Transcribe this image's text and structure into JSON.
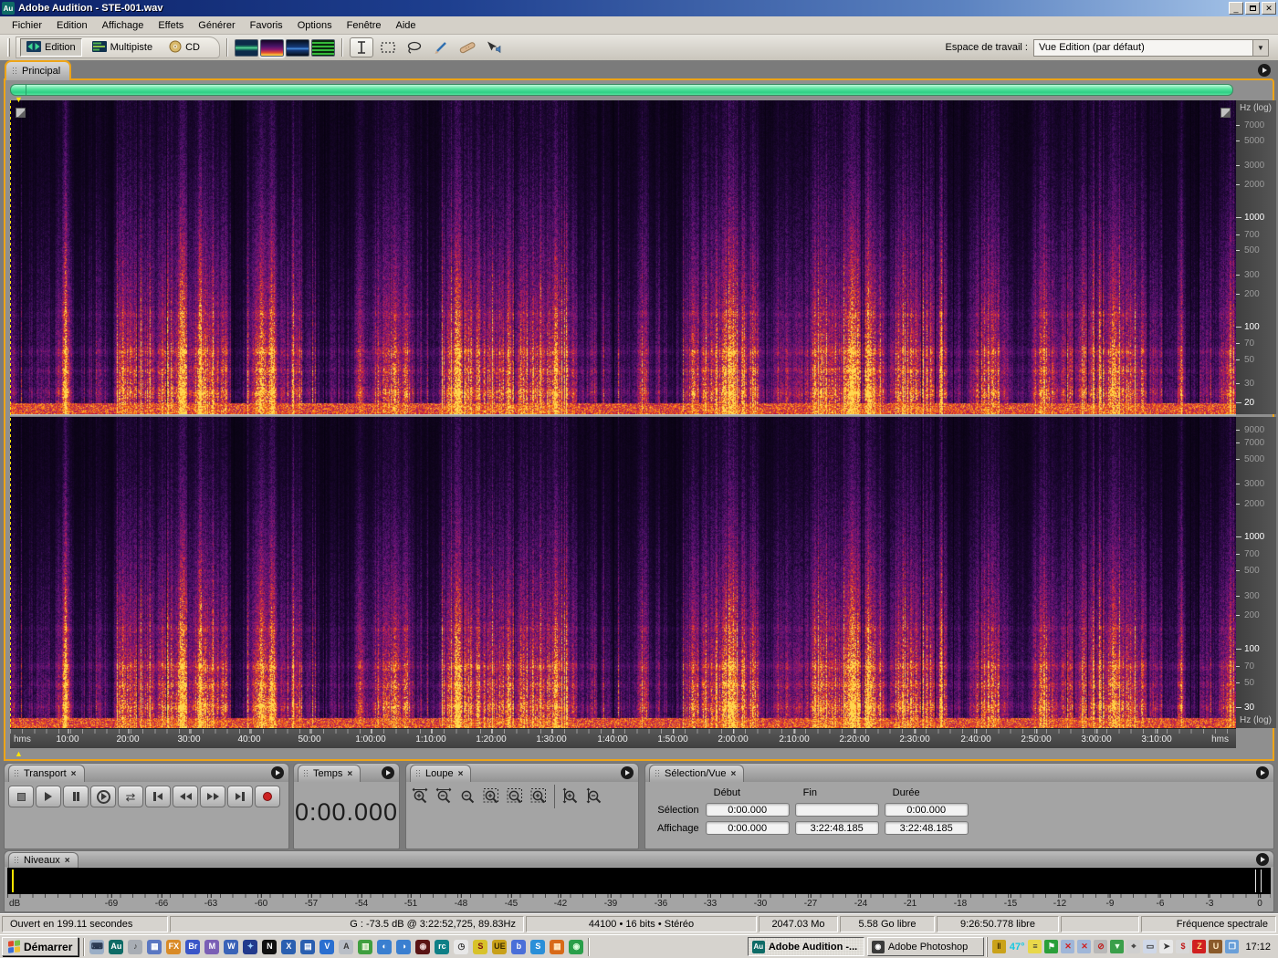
{
  "window": {
    "title": "Adobe Audition - STE-001.wav",
    "icon_label": "Au"
  },
  "icons": {
    "close_small": "×",
    "minimize": "_",
    "close_x": "✕",
    "dropdown": "▼",
    "marker_down": "▼",
    "marker_up": "▲",
    "loop": "⇄"
  },
  "menu": {
    "items": [
      "Fichier",
      "Edition",
      "Affichage",
      "Effets",
      "Générer",
      "Favoris",
      "Options",
      "Fenêtre",
      "Aide"
    ]
  },
  "toolbar": {
    "modes": [
      {
        "label": "Edition",
        "active": true
      },
      {
        "label": "Multipiste",
        "active": false
      },
      {
        "label": "CD",
        "active": false
      }
    ],
    "views": [
      "waveform-view",
      "spectral-frequency-view",
      "spectral-pan-view",
      "spectral-phase-view"
    ],
    "active_view": 1,
    "tools": [
      "time-selection-tool",
      "marquee-selection-tool",
      "lasso-selection-tool",
      "effects-paintbrush-tool",
      "spot-healing-tool",
      "scrub-tool"
    ],
    "active_tool": 0,
    "workspace_label": "Espace de travail :",
    "workspace_value": "Vue Edition (par défaut)"
  },
  "panels": {
    "main": {
      "tab": "Principal",
      "freq_unit": "Hz (log)",
      "freq_top": [
        {
          "label": "7000",
          "major": false
        },
        {
          "label": "5000",
          "major": false
        },
        {
          "label": "3000",
          "major": false
        },
        {
          "label": "2000",
          "major": false
        },
        {
          "label": "1000",
          "major": true
        },
        {
          "label": "700",
          "major": false
        },
        {
          "label": "500",
          "major": false
        },
        {
          "label": "300",
          "major": false
        },
        {
          "label": "200",
          "major": false
        },
        {
          "label": "100",
          "major": true
        },
        {
          "label": "70",
          "major": false
        },
        {
          "label": "50",
          "major": false
        },
        {
          "label": "30",
          "major": false
        },
        {
          "label": "20",
          "major": true
        }
      ],
      "freq_bottom": [
        {
          "label": "9000",
          "major": false
        },
        {
          "label": "7000",
          "major": false
        },
        {
          "label": "5000",
          "major": false
        },
        {
          "label": "3000",
          "major": false
        },
        {
          "label": "2000",
          "major": false
        },
        {
          "label": "1000",
          "major": true
        },
        {
          "label": "700",
          "major": false
        },
        {
          "label": "500",
          "major": false
        },
        {
          "label": "300",
          "major": false
        },
        {
          "label": "200",
          "major": false
        },
        {
          "label": "100",
          "major": true
        },
        {
          "label": "70",
          "major": false
        },
        {
          "label": "50",
          "major": false
        },
        {
          "label": "30",
          "major": true
        }
      ],
      "time_unit": "hms",
      "time_ticks": [
        "10:00",
        "20:00",
        "30:00",
        "40:00",
        "50:00",
        "1:00:00",
        "1:10:00",
        "1:20:00",
        "1:30:00",
        "1:40:00",
        "1:50:00",
        "2:00:00",
        "2:10:00",
        "2:20:00",
        "2:30:00",
        "2:40:00",
        "2:50:00",
        "3:00:00",
        "3:10:00"
      ]
    },
    "transport": {
      "tab": "Transport",
      "buttons": [
        "stop",
        "play",
        "pause",
        "play-from-cursor",
        "loop-play",
        "go-to-beginning",
        "rewind",
        "fast-forward",
        "go-to-end",
        "record"
      ]
    },
    "temps": {
      "tab": "Temps",
      "value": "0:00.000"
    },
    "loupe": {
      "tab": "Loupe",
      "buttons": [
        "zoom-in-horizontal",
        "zoom-out-horizontal",
        "zoom-out-full",
        "zoom-to-selection",
        "zoom-in-selection-left",
        "zoom-in-selection-right",
        "zoom-in-vertical",
        "zoom-out-vertical"
      ]
    },
    "selection": {
      "tab": "Sélection/Vue",
      "columns": [
        "Début",
        "Fin",
        "Durée"
      ],
      "rows": [
        {
          "label": "Sélection",
          "values": [
            "0:00.000",
            "",
            "0:00.000"
          ]
        },
        {
          "label": "Affichage",
          "values": [
            "0:00.000",
            "3:22:48.185",
            "3:22:48.185"
          ]
        }
      ]
    },
    "niveaux": {
      "tab": "Niveaux",
      "unit": "dB",
      "ticks": [
        "-69",
        "-66",
        "-63",
        "-60",
        "-57",
        "-54",
        "-51",
        "-48",
        "-45",
        "-42",
        "-39",
        "-36",
        "-33",
        "-30",
        "-27",
        "-24",
        "-21",
        "-18",
        "-15",
        "-12",
        "-9",
        "-6",
        "-3",
        "0"
      ]
    }
  },
  "statusbar": {
    "cells": [
      "Ouvert en 199.11 secondes",
      "G : -73.5 dB @ 3:22:52,725, 89.83Hz",
      "44100 • 16 bits • Stéréo",
      "2047.03 Mo",
      "5.58 Go libre",
      "9:26:50.778 libre",
      "",
      "Fréquence spectrale"
    ]
  },
  "taskbar": {
    "start_label": "Démarrer",
    "flag_colors": [
      "#e04a2a",
      "#7ac043",
      "#3a6fd8",
      "#f0c030"
    ],
    "quick_launch": [
      {
        "name": "keyboard-icon",
        "bg": "#9aaec6",
        "glyph": "⌨",
        "fg": "#23324a"
      },
      {
        "name": "audition-icon",
        "bg": "#0e6b66",
        "glyph": "Au",
        "fg": "#ffffff"
      },
      {
        "name": "media-player-icon",
        "bg": "#a8adb4",
        "glyph": "♪",
        "fg": "#3a3a3a"
      },
      {
        "name": "calculator-icon",
        "bg": "#5a77c2",
        "glyph": "▦",
        "fg": "#ffffff"
      },
      {
        "name": "fx-icon",
        "bg": "#d98a26",
        "glyph": "FX",
        "fg": "#ffffff"
      },
      {
        "name": "bridge-icon",
        "bg": "#3a56c8",
        "glyph": "Br",
        "fg": "#ffffff"
      },
      {
        "name": "infopath-icon",
        "bg": "#7a5fb5",
        "glyph": "M",
        "fg": "#ffffff"
      },
      {
        "name": "word-icon",
        "bg": "#3a63b8",
        "glyph": "W",
        "fg": "#ffffff"
      },
      {
        "name": "browser-icon",
        "bg": "#223a8c",
        "glyph": "✦",
        "fg": "#9fd0ff"
      },
      {
        "name": "notes-icon",
        "bg": "#111111",
        "glyph": "N",
        "fg": "#ffffff"
      },
      {
        "name": "excel-icon",
        "bg": "#2a5fb0",
        "glyph": "X",
        "fg": "#ffffff"
      },
      {
        "name": "project-icon",
        "bg": "#2a5fb0",
        "glyph": "▤",
        "fg": "#ffffff"
      },
      {
        "name": "visio-icon",
        "bg": "#2a6fd0",
        "glyph": "V",
        "fg": "#ffffff"
      },
      {
        "name": "document-icon",
        "bg": "#b9bec6",
        "glyph": "A",
        "fg": "#3a3a3a"
      },
      {
        "name": "chart-icon",
        "bg": "#3f9f3f",
        "glyph": "▥",
        "fg": "#ffe"
      },
      {
        "name": "globe-icon",
        "bg": "#3a7fd0",
        "glyph": "◐",
        "fg": "#ffffff"
      },
      {
        "name": "globe2-icon",
        "bg": "#3a7fd0",
        "glyph": "◑",
        "fg": "#ffffff"
      },
      {
        "name": "camera-icon",
        "bg": "#5a1414",
        "glyph": "◉",
        "fg": "#e8d0d0"
      },
      {
        "name": "rc-icon",
        "bg": "#0e7f86",
        "glyph": "rc",
        "fg": "#ffffff"
      },
      {
        "name": "clock-icon",
        "bg": "#e8e8e8",
        "glyph": "◷",
        "fg": "#333333"
      },
      {
        "name": "sbp-icon",
        "bg": "#d8c22a",
        "glyph": "S",
        "fg": "#7a1010"
      },
      {
        "name": "ue-icon",
        "bg": "#c8a018",
        "glyph": "UE",
        "fg": "#3a2a00"
      },
      {
        "name": "blue-app-icon",
        "bg": "#4a6fd8",
        "glyph": "b",
        "fg": "#ffffff"
      },
      {
        "name": "sync-icon",
        "bg": "#2a8fd8",
        "glyph": "S",
        "fg": "#ffffff"
      },
      {
        "name": "pdf-grid-icon",
        "bg": "#d86a18",
        "glyph": "▦",
        "fg": "#ffe8c0"
      },
      {
        "name": "green-app-icon",
        "bg": "#2a9f4a",
        "glyph": "◉",
        "fg": "#e0ffe0"
      }
    ],
    "tasks": [
      {
        "label": "Adobe Audition -...",
        "active": true,
        "icon_glyph": "Au",
        "icon_bg": "#0e6b66"
      },
      {
        "label": "Adobe Photoshop",
        "active": false,
        "icon_glyph": "◉",
        "icon_bg": "#3a3a3a"
      }
    ],
    "tray_temp": "47°",
    "tray": [
      {
        "name": "meter-icon",
        "bg": "#caa21a",
        "glyph": "‖",
        "fg": "#3a2a00"
      },
      {
        "name": "menu-lines-icon",
        "bg": "#e8d84a",
        "glyph": "≡",
        "fg": "#333333"
      },
      {
        "name": "flag-icon",
        "bg": "#2a9f3a",
        "glyph": "⚑",
        "fg": "#ffffff"
      },
      {
        "name": "network-error-icon",
        "bg": "#9fb6d8",
        "glyph": "✕",
        "fg": "#d02020"
      },
      {
        "name": "network-error2-icon",
        "bg": "#9fb6d8",
        "glyph": "✕",
        "fg": "#d02020"
      },
      {
        "name": "blocked-icon",
        "bg": "#b8b8b8",
        "glyph": "⊘",
        "fg": "#c02020"
      },
      {
        "name": "download-icon",
        "bg": "#3a9f4a",
        "glyph": "▼",
        "fg": "#e8ffe8"
      },
      {
        "name": "mouse-icon",
        "bg": "#cfcfcf",
        "glyph": "⌖",
        "fg": "#333333"
      },
      {
        "name": "display-icon",
        "bg": "#cfd8e8",
        "glyph": "▭",
        "fg": "#333333"
      },
      {
        "name": "cursor-icon",
        "bg": "#e8e8e8",
        "glyph": "➤",
        "fg": "#333333"
      },
      {
        "name": "currency-icon",
        "bg": "#d8d8d8",
        "glyph": "$",
        "fg": "#c01818"
      },
      {
        "name": "flash-icon",
        "bg": "#d02020",
        "glyph": "Z",
        "fg": "#ffe080"
      },
      {
        "name": "jar-icon",
        "bg": "#8a5a2a",
        "glyph": "U",
        "fg": "#ffe8c0"
      },
      {
        "name": "doc-icon",
        "bg": "#6a9fd8",
        "glyph": "❒",
        "fg": "#ffffff"
      }
    ],
    "clock": "17:12"
  },
  "spectrogram": {
    "palette": [
      "#06020e",
      "#1c0632",
      "#451063",
      "#6f1478",
      "#9a1a66",
      "#c22347",
      "#e54a22",
      "#fb8c16",
      "#ffd84f"
    ],
    "hotspots": [
      {
        "x": 0.045,
        "w": 0.004,
        "s": 0.5
      },
      {
        "x": 0.14,
        "w": 0.008,
        "s": 0.55
      },
      {
        "x": 0.155,
        "w": 0.004,
        "s": 0.4
      },
      {
        "x": 0.205,
        "w": 0.018,
        "s": 0.8
      },
      {
        "x": 0.215,
        "w": 0.008,
        "s": 0.5
      },
      {
        "x": 0.285,
        "w": 0.012,
        "s": 0.5
      },
      {
        "x": 0.3,
        "w": 0.004,
        "s": 0.35
      },
      {
        "x": 0.365,
        "w": 0.01,
        "s": 0.45
      },
      {
        "x": 0.445,
        "w": 0.004,
        "s": 0.5
      },
      {
        "x": 0.59,
        "w": 0.01,
        "s": 0.35
      },
      {
        "x": 0.64,
        "w": 0.12,
        "s": 0.1
      },
      {
        "x": 0.685,
        "w": 0.012,
        "s": 0.45
      },
      {
        "x": 0.7,
        "w": 0.006,
        "s": 0.4
      },
      {
        "x": 0.76,
        "w": 0.004,
        "s": 0.45
      },
      {
        "x": 0.85,
        "w": 0.1,
        "s": 0.08
      },
      {
        "x": 0.9,
        "w": 0.008,
        "s": 0.35
      },
      {
        "x": 0.955,
        "w": 0.005,
        "s": 0.4
      }
    ],
    "bands": [
      {
        "f": 0.68,
        "w": 0.015,
        "s": 0.12
      },
      {
        "f": 0.8,
        "w": 0.02,
        "s": 0.25
      },
      {
        "f": 0.86,
        "w": 0.015,
        "s": 0.2
      },
      {
        "f": 0.93,
        "w": 0.02,
        "s": 0.25
      }
    ]
  }
}
